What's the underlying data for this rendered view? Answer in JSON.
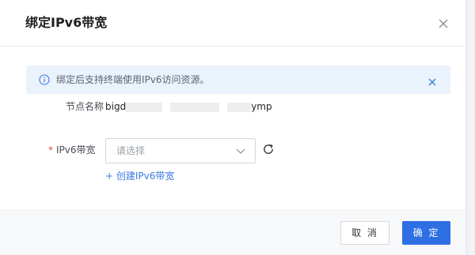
{
  "dialog": {
    "title": "绑定IPv6带宽"
  },
  "alert": {
    "text": "绑定后支持终端使用IPv6访问资源。"
  },
  "form": {
    "node_name_label": "节点名称",
    "node_name_prefix": "bigd",
    "node_name_suffix": "ymp",
    "required_mark": "*",
    "ipv6_label": "IPv6带宽",
    "ipv6_select_placeholder": "请选择",
    "create_link": "+ 创建IPv6带宽"
  },
  "footer": {
    "cancel_label": "取 消",
    "ok_label": "确 定"
  },
  "colors": {
    "primary": "#2f6fe4",
    "link": "#3b7be0",
    "alert_bg": "#eaf3fc",
    "required": "#e0473c"
  },
  "icons": {
    "close": "close-icon",
    "info": "info-icon",
    "alert_close": "alert-close-icon",
    "dropdown": "chevron-down-icon",
    "refresh": "refresh-icon"
  }
}
